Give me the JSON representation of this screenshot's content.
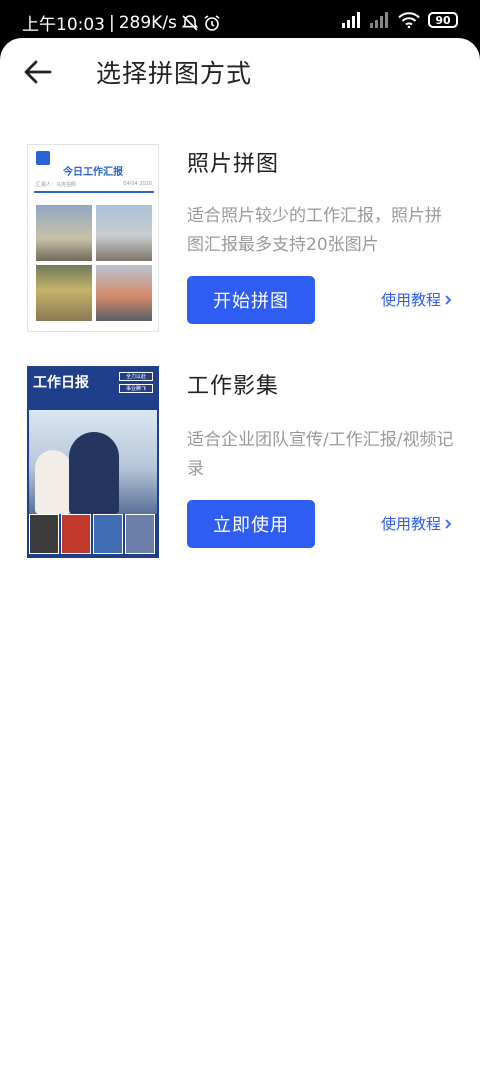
{
  "status_bar": {
    "time": "上午10:03",
    "speed": "289K/s",
    "battery": "90"
  },
  "header": {
    "title": "选择拼图方式"
  },
  "cards": [
    {
      "title": "照片拼图",
      "description": "适合照片较少的工作汇报，照片拼图汇报最多支持20张图片",
      "button_label": "开始拼图",
      "tutorial_label": "使用教程",
      "thumbnail": {
        "heading": "今日工作汇报",
        "reporter": "汇报人：",
        "reporter_name": "马克拍照",
        "date": "04/04 2020"
      }
    },
    {
      "title": "工作影集",
      "description": "适合企业团队宣传/工作汇报/视频记录",
      "button_label": "立即使用",
      "tutorial_label": "使用教程",
      "thumbnail": {
        "heading": "工作日报",
        "tag1": "全力以赴",
        "tag2": "事业腾飞"
      }
    }
  ],
  "colors": {
    "accent": "#2f5cf2",
    "desc_text": "#9a9a9a"
  },
  "icons": {
    "back": "arrow-left-icon",
    "tutorial_chevron": "chevron-right-icon"
  }
}
